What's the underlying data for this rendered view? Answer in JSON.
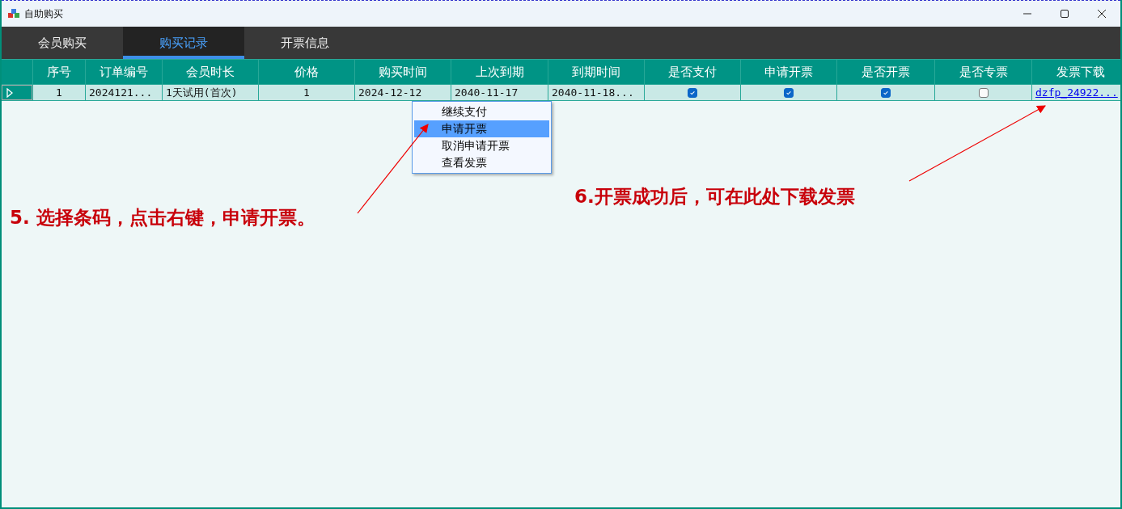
{
  "window": {
    "title": "自助购买"
  },
  "tabs": [
    {
      "label": "会员购买",
      "selected": false
    },
    {
      "label": "购买记录",
      "selected": true
    },
    {
      "label": "开票信息",
      "selected": false
    }
  ],
  "table": {
    "columns": [
      "序号",
      "订单编号",
      "会员时长",
      "价格",
      "购买时间",
      "上次到期",
      "到期时间",
      "是否支付",
      "申请开票",
      "是否开票",
      "是否专票",
      "发票下载"
    ],
    "rows": [
      {
        "selected": true,
        "cells": [
          {
            "kind": "number",
            "text": "1"
          },
          {
            "kind": "text",
            "text": "2024121..."
          },
          {
            "kind": "text",
            "text": "1天试用(首次)"
          },
          {
            "kind": "number",
            "text": "1"
          },
          {
            "kind": "text",
            "text": "2024-12-12"
          },
          {
            "kind": "text",
            "text": "2040-11-17"
          },
          {
            "kind": "text",
            "text": "2040-11-18..."
          },
          {
            "kind": "checkbox",
            "checked": true
          },
          {
            "kind": "checkbox",
            "checked": true
          },
          {
            "kind": "checkbox",
            "checked": true
          },
          {
            "kind": "checkbox",
            "checked": false
          },
          {
            "kind": "link",
            "text": "dzfp_24922..."
          }
        ]
      }
    ]
  },
  "context_menu": {
    "items": [
      {
        "label": "继续支付",
        "selected": false
      },
      {
        "label": "申请开票",
        "selected": true
      },
      {
        "label": "取消申请开票",
        "selected": false
      },
      {
        "label": "查看发票",
        "selected": false
      }
    ]
  },
  "annotations": [
    {
      "text": "5. 选择条码，点击右键，申请开票。"
    },
    {
      "text": "6.开票成功后，可在此处下载发票"
    }
  ]
}
